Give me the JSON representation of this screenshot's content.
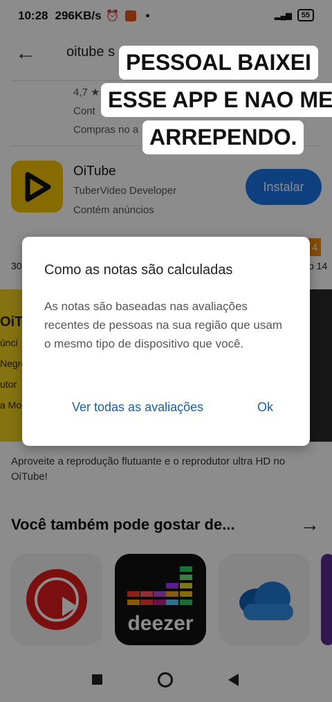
{
  "status_bar": {
    "time": "10:28",
    "speed": "296KB/s",
    "battery": "55"
  },
  "search": {
    "query": "oitube s"
  },
  "app1": {
    "rating": "4,7 ★",
    "contains": "Cont",
    "purchases": "Compras no a"
  },
  "app2": {
    "name": "OiTube",
    "developer": "TuberVideo Developer",
    "ads": "Contém anúncios",
    "install_label": "Instalar"
  },
  "partials": {
    "left_num": "30",
    "right_num": "o 14",
    "badge": "4",
    "promo_left": [
      "OiTu",
      "únci",
      "Negro",
      "utor",
      "a Mo"
    ]
  },
  "description": "Aproveite a reprodução flutuante e o reprodutor ultra HD no OiTube!",
  "recommendations": {
    "title": "Você também pode gostar de...",
    "deezer_word": "deezer"
  },
  "dialog": {
    "title": "Como as notas são calculadas",
    "body": "As notas são baseadas nas avaliações recentes de pessoas na sua região que usam o mesmo tipo de dispositivo que você.",
    "see_all": "Ver todas as avaliações",
    "ok": "Ok"
  },
  "caption": {
    "line1": "PESSOAL BAIXEI",
    "line2": "ESSE APP E NAO ME",
    "line3": "ARREPENDO."
  },
  "colors": {
    "accent_blue": "#1a73e8",
    "link_blue": "#1a5fa8",
    "oitube_yellow": "#f4c400"
  }
}
